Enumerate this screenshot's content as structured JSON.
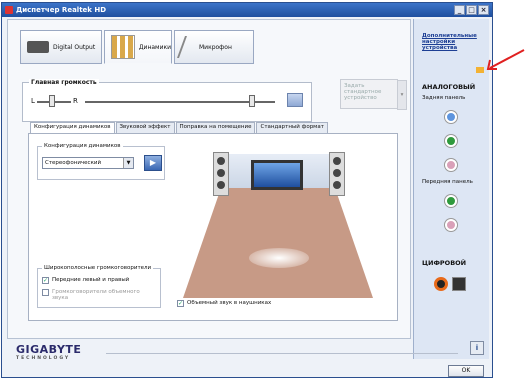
{
  "window": {
    "title": "Диспетчер Realtek HD",
    "controls": [
      "_",
      "□",
      "×"
    ]
  },
  "device_tabs": [
    {
      "label": "Digital Output"
    },
    {
      "label": "Динамики"
    },
    {
      "label": "Микрофон"
    }
  ],
  "volume": {
    "label": "Главная громкость",
    "left": "L",
    "right": "R",
    "level_fraction": 0.88,
    "balance_fraction": 0.45
  },
  "default_device": {
    "label": "Задать стандартное устройство"
  },
  "subtabs": [
    "Конфигурация динамиков",
    "Звуковой эффект",
    "Поправка на помещение",
    "Стандартный формат"
  ],
  "speaker_config": {
    "group_label": "Конфигурация динамиков",
    "selected": "Стереофонический"
  },
  "wide_speakers": {
    "group_label": "Широкополосные громкоговорители",
    "front": {
      "label": "Передние левый и правый",
      "checked": true
    },
    "surround": {
      "label": "Громкоговорители объемного звука",
      "checked": false
    }
  },
  "headphones_option": {
    "label": "Объемный звук в наушниках",
    "checked": true
  },
  "sidebar": {
    "advanced_link": "Дополнительные настройки устройства",
    "analog_title": "АНАЛОГОВЫЙ",
    "rear_panel": "Задняя панель",
    "front_panel": "Передняя панель",
    "digital_title": "ЦИФРОВОЙ",
    "colors": {
      "blue": "#5e95de",
      "green": "#2f9a3d",
      "pink": "#d9a0b8"
    }
  },
  "brand": {
    "name": "GIGABYTE",
    "sub": "TECHNOLOGY"
  },
  "buttons": {
    "info": "i",
    "ok": "OK"
  }
}
